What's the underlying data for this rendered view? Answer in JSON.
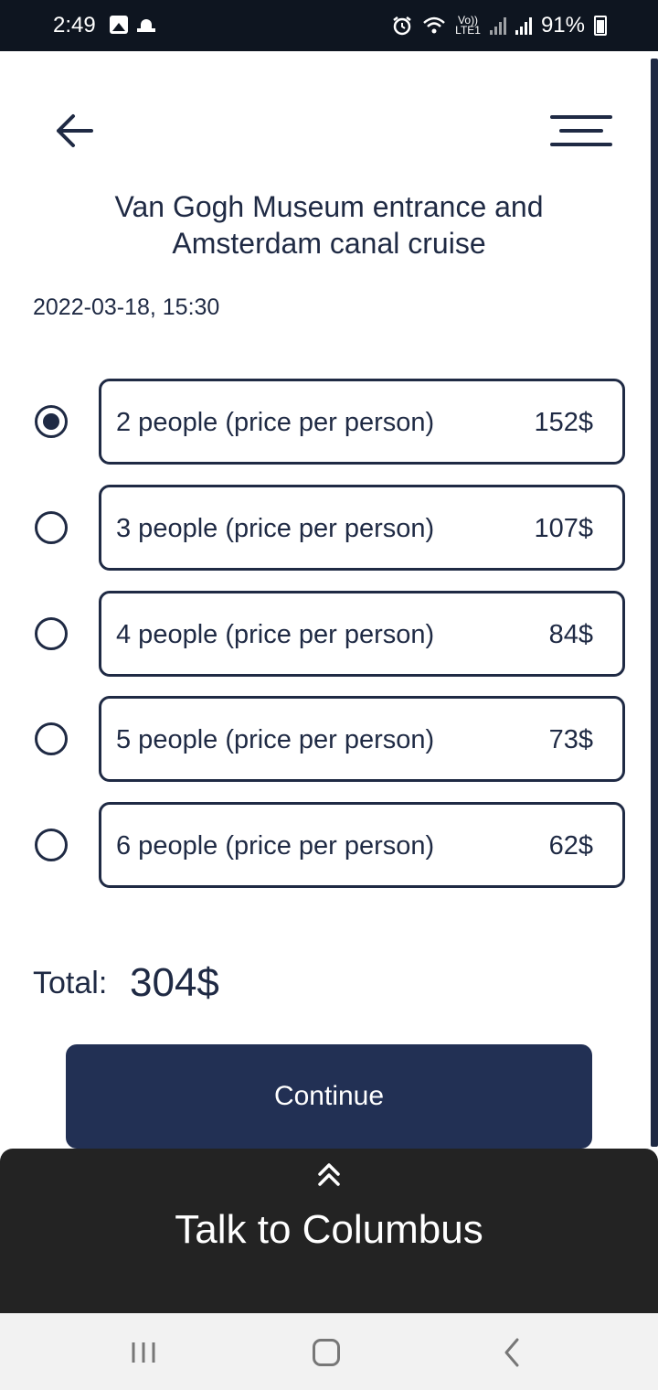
{
  "status_bar": {
    "time": "2:49",
    "volte": "Vo))",
    "lte": "LTE1",
    "battery": "91%",
    "icons": [
      "image-icon",
      "mosque-icon",
      "alarm-icon",
      "wifi-icon",
      "signal-icon",
      "battery-icon"
    ]
  },
  "header": {
    "back_icon": "arrow-left-icon",
    "menu_icon": "menu-icon",
    "title": "Van Gogh Museum entrance and Amsterdam canal cruise"
  },
  "booking": {
    "datetime": "2022-03-18, 15:30",
    "selected_index": 0,
    "options": [
      {
        "label": "2 people (price per person)",
        "price": "152$"
      },
      {
        "label": "3 people (price per person)",
        "price": "107$"
      },
      {
        "label": "4 people (price per person)",
        "price": "84$"
      },
      {
        "label": "5 people (price per person)",
        "price": "73$"
      },
      {
        "label": "6 people (price per person)",
        "price": "62$"
      }
    ],
    "total_label": "Total:",
    "total_value": "304$",
    "continue_label": "Continue"
  },
  "sheet": {
    "icon": "double-chevron-up-icon",
    "title": "Talk to Columbus"
  },
  "colors": {
    "primary": "#223054",
    "text": "#1f2a44",
    "sheet_bg": "#232323",
    "status_bg": "#0e1520"
  }
}
